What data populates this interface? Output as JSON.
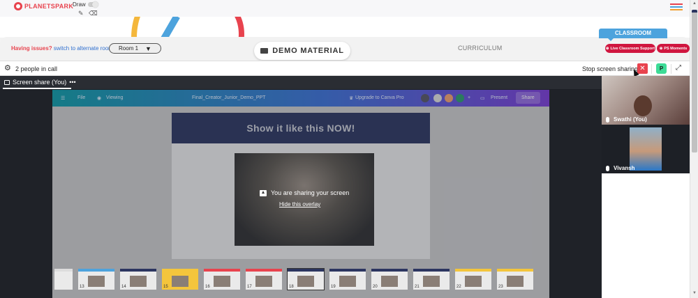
{
  "brand": {
    "logo_text": "PLANETSPARK"
  },
  "toolbar": {
    "draw_label": "Draw",
    "pencil_icon": "pencil-icon",
    "eraser_icon": "eraser-icon"
  },
  "room_bar": {
    "issue_text": "Having issues?",
    "switch_link": "switch to alternate room",
    "room_select": "Room 1",
    "demo_material": "DEMO MATERIAL",
    "curriculum": "CURRICULUM",
    "classroom": "CLASSROOM",
    "live_support": "Live Classroom Support",
    "ps_moments": "PS Moments"
  },
  "call_bar": {
    "people_count": "2 people in call",
    "stop_sharing": "Stop screen sharing",
    "participant_initial": "P"
  },
  "screen_share": {
    "tab_label": "Screen share (You)",
    "tab_more": "•••",
    "overlay_message": "You are sharing your screen",
    "overlay_hide": "Hide this overlay"
  },
  "canva": {
    "menu": "File",
    "viewing": "Viewing",
    "doc_title": "Final_Creator_Junior_Demo_PPT",
    "upgrade": "Upgrade to Canva Pro",
    "present": "Present",
    "share": "Share",
    "slide_title": "Show it like this NOW!",
    "thumb_numbers": [
      "",
      "13",
      "14",
      "15",
      "16",
      "17",
      "18",
      "19",
      "20",
      "21",
      "22",
      "23"
    ]
  },
  "participants": [
    {
      "name": "Swathi (You)"
    },
    {
      "name": "Vivansh"
    }
  ],
  "colors": {
    "brand_red": "#e8434e",
    "link_blue": "#2f6fcf",
    "classroom_blue": "#4da3dd",
    "pill_red": "#d0163f",
    "p_green": "#3ddc97"
  }
}
